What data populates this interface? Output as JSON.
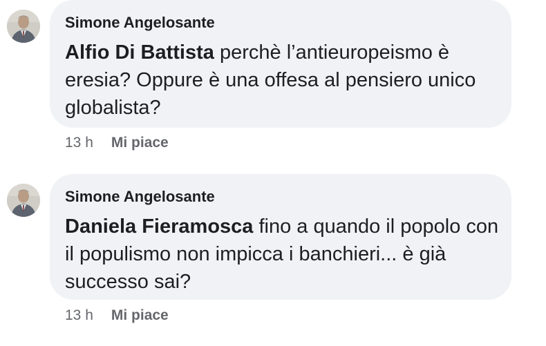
{
  "comments": [
    {
      "author": "Simone Angelosante",
      "mention": "Alfio Di Battista",
      "text": " perchè l’antieuropeismo è eresia? Oppure è una offesa al pensiero unico globalista?",
      "time": "13 h",
      "like_label": "Mi piace"
    },
    {
      "author": "Simone Angelosante",
      "mention": "Daniela Fieramosca",
      "text": " fino a quando il popolo con il populismo non impicca i banchieri... è già successo sai?",
      "time": "13 h",
      "like_label": "Mi piace"
    }
  ]
}
